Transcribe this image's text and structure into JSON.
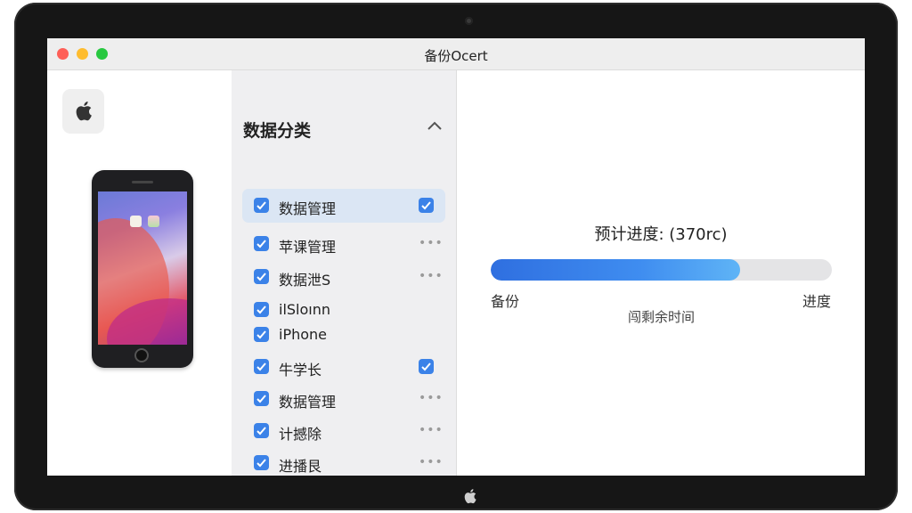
{
  "window": {
    "title": "备份Ocert"
  },
  "categories": {
    "header": "数据分类",
    "items": [
      {
        "label": "数据管理",
        "trailing": "checkbox",
        "selected": true
      },
      {
        "label": "苹课管理",
        "trailing": "more"
      },
      {
        "label": "数据泄S",
        "trailing": "more"
      },
      {
        "label": "ilSloınn",
        "trailing": "none"
      },
      {
        "label": "iPhone",
        "trailing": "none"
      },
      {
        "label": "牛学长",
        "trailing": "checkbox"
      },
      {
        "label": "数据管理",
        "trailing": "more"
      },
      {
        "label": "计撼除",
        "trailing": "more"
      },
      {
        "label": "进播艮",
        "trailing": "more"
      }
    ],
    "more_glyph": "•••"
  },
  "progress": {
    "title": "预计进度: (370rc)",
    "percent": 73,
    "left_label": "备份",
    "right_label": "进度",
    "remaining_label": "闯剩余时间"
  },
  "colors": {
    "accent": "#3b82e8",
    "selected_row": "#dbe6f4",
    "progress_fill": "#3f8df0",
    "traffic_red": "#fe5f57",
    "traffic_yellow": "#febc2e",
    "traffic_green": "#28c840"
  },
  "icons": {
    "app_logo": "apple-icon",
    "collapse": "chevron-up-icon",
    "checkbox": "checkmark-icon"
  }
}
